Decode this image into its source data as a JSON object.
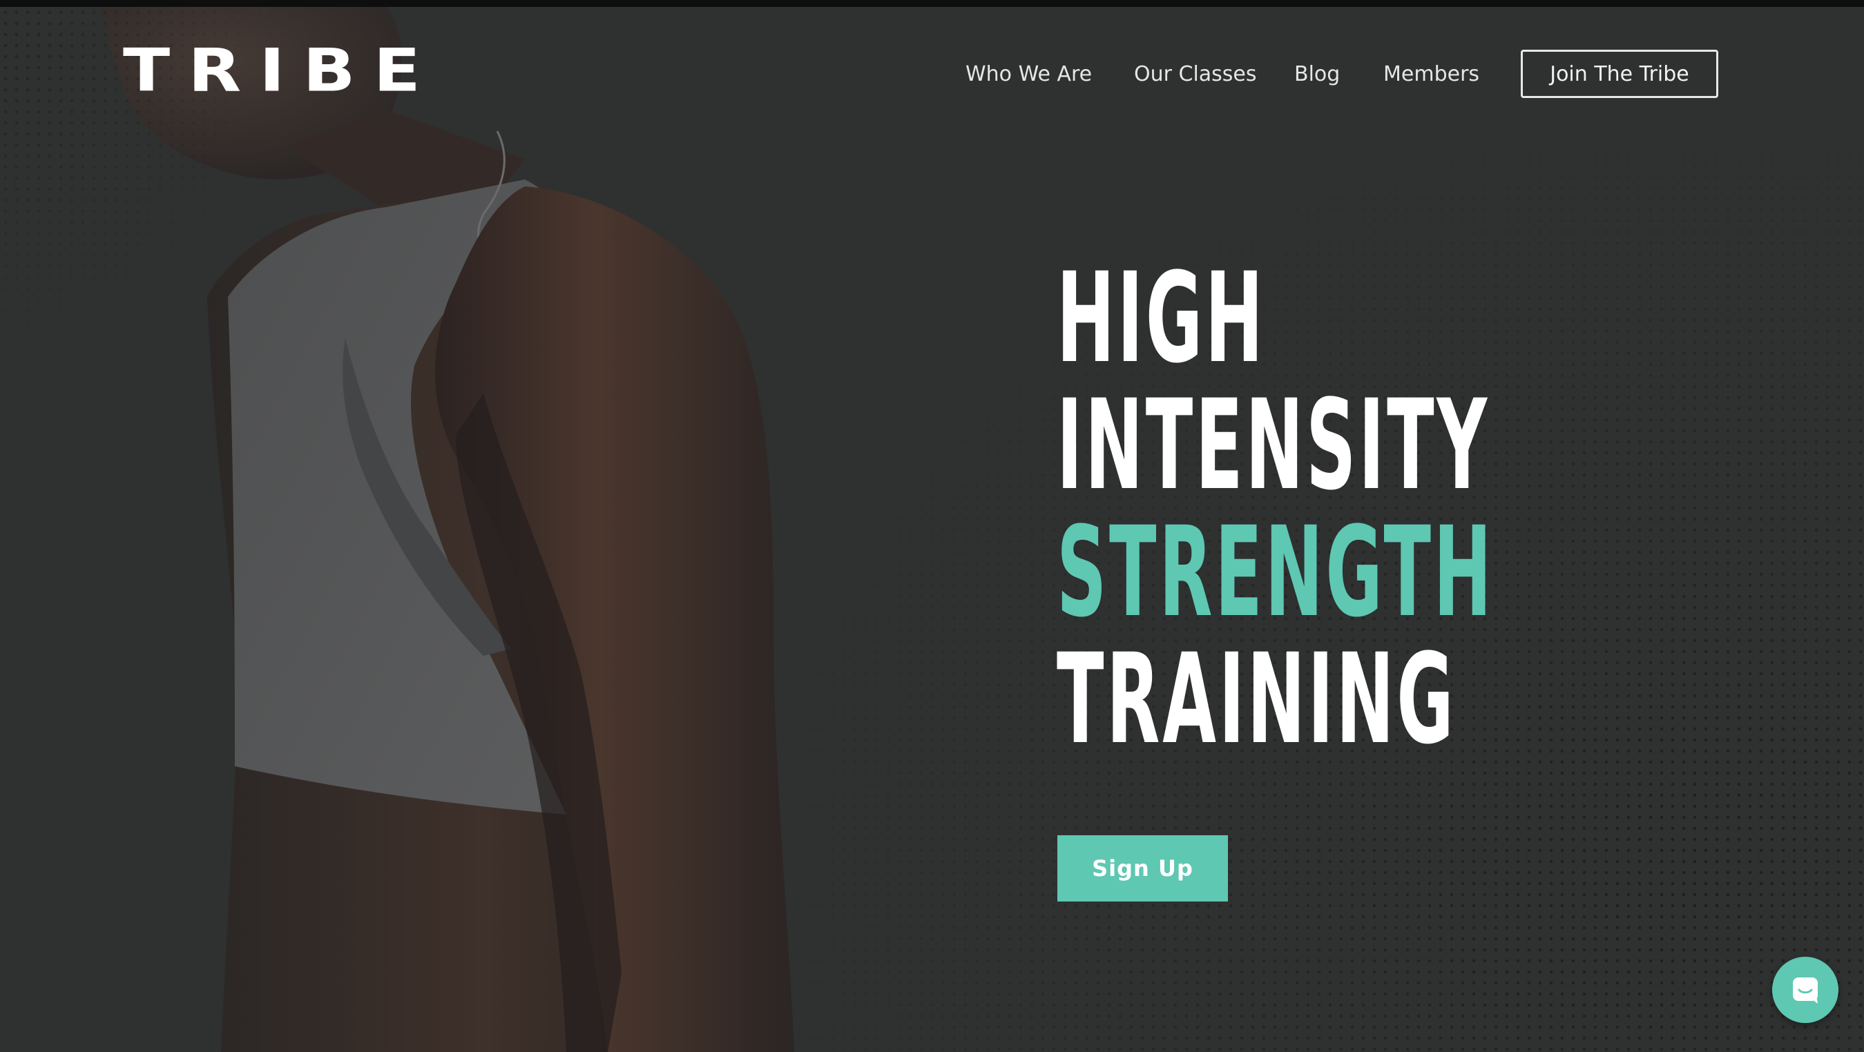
{
  "brand": {
    "logo_text": "TRIBE"
  },
  "nav": {
    "items": [
      {
        "label": "Who We Are"
      },
      {
        "label": "Our Classes"
      },
      {
        "label": "Blog"
      },
      {
        "label": "Members"
      }
    ],
    "cta_label": "Join The Tribe"
  },
  "hero": {
    "lines": [
      "HIGH",
      "INTENSITY",
      "STRENGTH",
      "TRAINING"
    ],
    "accent_line": "STRENGTH",
    "button_label": "Sign Up"
  },
  "chat": {
    "icon": "chat-icon"
  },
  "colors": {
    "accent": "#5ec8b2",
    "background": "#2f3030",
    "text": "#ffffff"
  }
}
